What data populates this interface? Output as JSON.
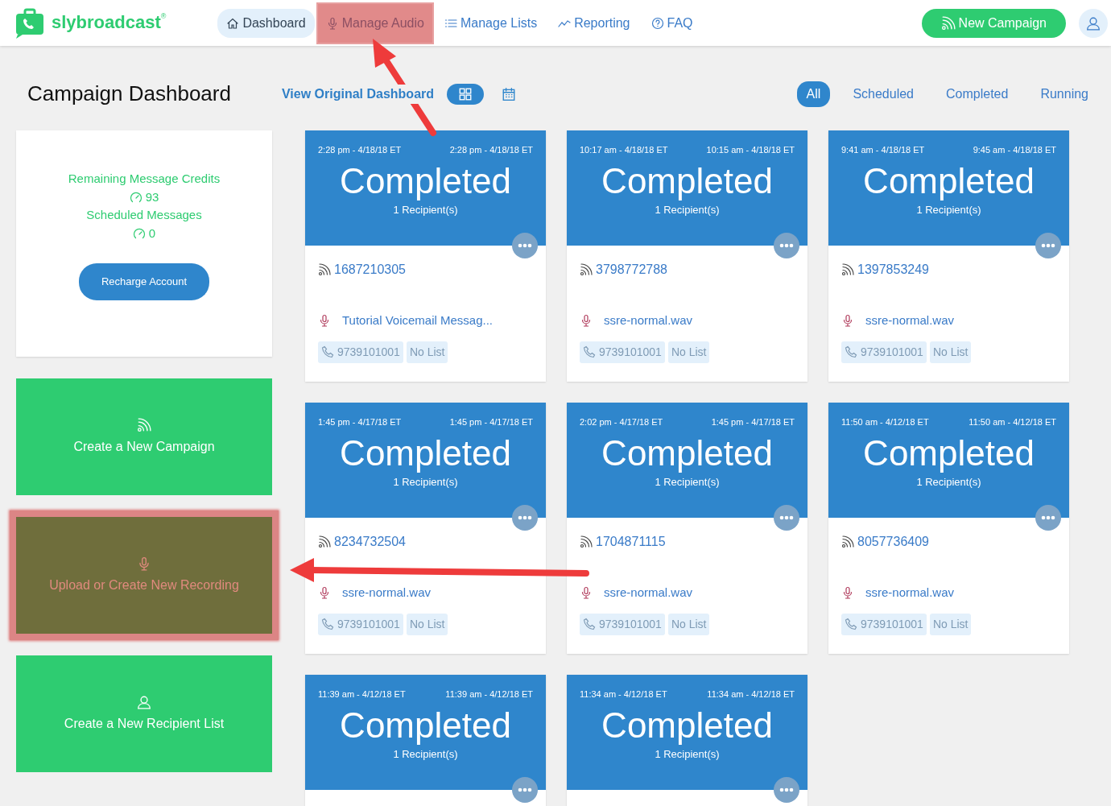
{
  "brand": {
    "name": "slybroadcast",
    "mark": "®"
  },
  "nav": [
    {
      "label": "Dashboard",
      "kind": "house",
      "selected": true,
      "highlighted": false
    },
    {
      "label": "Manage Audio",
      "kind": "mic",
      "selected": false,
      "highlighted": true
    },
    {
      "label": "Manage Lists",
      "kind": "list",
      "selected": false,
      "highlighted": false
    },
    {
      "label": "Reporting",
      "kind": "trend",
      "selected": false,
      "highlighted": false
    },
    {
      "label": "FAQ",
      "kind": "question",
      "selected": false,
      "highlighted": false
    }
  ],
  "new_campaign_button": "New Campaign",
  "page_title": "Campaign Dashboard",
  "view_original_link": "View Original Dashboard",
  "view_toggles": [
    {
      "kind": "grid",
      "selected": true
    },
    {
      "kind": "calendar",
      "selected": false
    }
  ],
  "filters": [
    {
      "label": "All",
      "selected": true
    },
    {
      "label": "Scheduled",
      "selected": false
    },
    {
      "label": "Completed",
      "selected": false
    },
    {
      "label": "Running",
      "selected": false
    }
  ],
  "credits_panel": {
    "credits_label": "Remaining Message Credits",
    "credits_value": "93",
    "scheduled_label": "Scheduled Messages",
    "scheduled_value": "0",
    "button": "Recharge Account"
  },
  "action_tiles": [
    {
      "label": "Create a New Campaign",
      "kind": "rss",
      "highlighted": false
    },
    {
      "label": "Upload or Create New Recording",
      "kind": "mic",
      "highlighted": true
    },
    {
      "label": "Create a New Recipient List",
      "kind": "user",
      "highlighted": false
    }
  ],
  "campaigns": [
    {
      "start": "2:28 pm - 4/18/18 ET",
      "end": "2:28 pm - 4/18/18 ET",
      "status": "Completed",
      "recipients": "1 Recipient(s)",
      "number": "1687210305",
      "recording": "Tutorial Voicemail Messag...",
      "caller_id": "9739101001",
      "list": "No List"
    },
    {
      "start": "10:17 am - 4/18/18 ET",
      "end": "10:15 am - 4/18/18 ET",
      "status": "Completed",
      "recipients": "1 Recipient(s)",
      "number": "3798772788",
      "recording": "ssre-normal.wav",
      "caller_id": "9739101001",
      "list": "No List"
    },
    {
      "start": "9:41 am - 4/18/18 ET",
      "end": "9:45 am - 4/18/18 ET",
      "status": "Completed",
      "recipients": "1 Recipient(s)",
      "number": "1397853249",
      "recording": "ssre-normal.wav",
      "caller_id": "9739101001",
      "list": "No List"
    },
    {
      "start": "1:45 pm - 4/17/18 ET",
      "end": "1:45 pm - 4/17/18 ET",
      "status": "Completed",
      "recipients": "1 Recipient(s)",
      "number": "8234732504",
      "recording": "ssre-normal.wav",
      "caller_id": "9739101001",
      "list": "No List"
    },
    {
      "start": "2:02 pm - 4/17/18 ET",
      "end": "1:45 pm - 4/17/18 ET",
      "status": "Completed",
      "recipients": "1 Recipient(s)",
      "number": "1704871115",
      "recording": "ssre-normal.wav",
      "caller_id": "9739101001",
      "list": "No List"
    },
    {
      "start": "11:50 am - 4/12/18 ET",
      "end": "11:50 am - 4/12/18 ET",
      "status": "Completed",
      "recipients": "1 Recipient(s)",
      "number": "8057736409",
      "recording": "ssre-normal.wav",
      "caller_id": "9739101001",
      "list": "No List"
    },
    {
      "start": "11:39 am - 4/12/18 ET",
      "end": "11:39 am - 4/12/18 ET",
      "status": "Completed",
      "recipients": "1 Recipient(s)"
    },
    {
      "start": "11:34 am - 4/12/18 ET",
      "end": "11:34 am - 4/12/18 ET",
      "status": "Completed",
      "recipients": "1 Recipient(s)"
    }
  ]
}
